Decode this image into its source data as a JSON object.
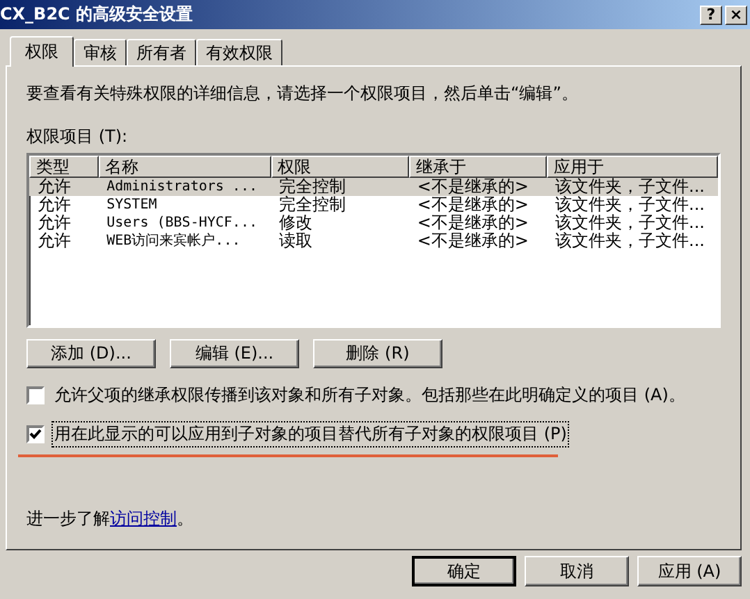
{
  "window": {
    "title": "CX_B2C 的高级安全设置",
    "help": "?",
    "close": "×"
  },
  "tabs": [
    {
      "label": "权限",
      "selected": true
    },
    {
      "label": "审核",
      "selected": false
    },
    {
      "label": "所有者",
      "selected": false
    },
    {
      "label": "有效权限",
      "selected": false
    }
  ],
  "intro": "要查看有关特殊权限的详细信息，请选择一个权限项目，然后单击“编辑”。",
  "list_label": "权限项目 (T):",
  "table": {
    "columns": [
      "类型",
      "名称",
      "权限",
      "继承于",
      "应用于"
    ],
    "rows": [
      {
        "cells": [
          "允许",
          "Administrators ...",
          "完全控制",
          "<不是继承的>",
          "该文件夹，子文件..."
        ],
        "selected": true
      },
      {
        "cells": [
          "允许",
          "SYSTEM",
          "完全控制",
          "<不是继承的>",
          "该文件夹，子文件..."
        ],
        "selected": false
      },
      {
        "cells": [
          "允许",
          "Users (BBS-HYCF...",
          "修改",
          "<不是继承的>",
          "该文件夹，子文件..."
        ],
        "selected": false
      },
      {
        "cells": [
          "允许",
          "WEB访问来宾帐户...",
          "读取",
          "<不是继承的>",
          "该文件夹，子文件..."
        ],
        "selected": false
      }
    ]
  },
  "list_buttons": [
    "添加 (D)...",
    "编辑 (E)...",
    "删除 (R)"
  ],
  "checkboxes": [
    {
      "label": "允许父项的继承权限传播到该对象和所有子对象。包括那些在此明确定义的项目 (A)。",
      "checked": false,
      "underlined": false
    },
    {
      "label": "用在此显示的可以应用到子对象的项目替代所有子对象的权限项目 (P)",
      "checked": true,
      "underlined": true
    }
  ],
  "learn_more": {
    "prefix": "进一步了解",
    "link": "访问控制",
    "suffix": "。"
  },
  "buttons": [
    {
      "label": "确定",
      "default": true
    },
    {
      "label": "取消",
      "default": false
    },
    {
      "label": "应用 (A)",
      "default": false
    }
  ]
}
